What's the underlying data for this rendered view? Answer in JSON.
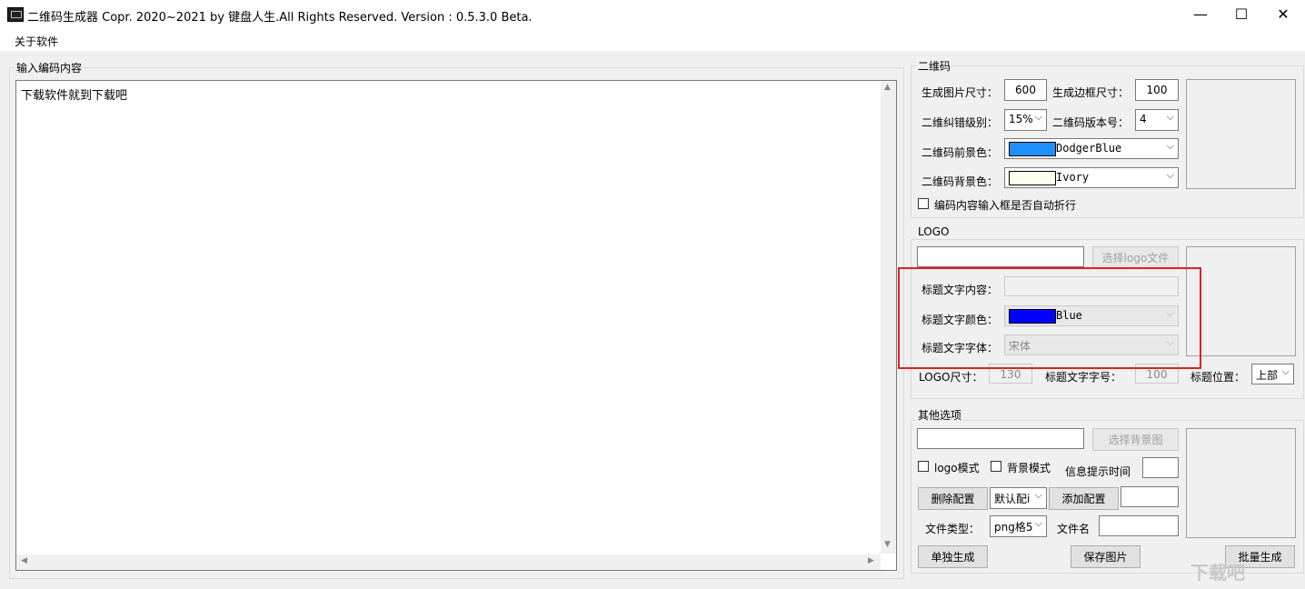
{
  "window": {
    "title": "二维码生成器  Copr. 2020~2021 by 键盘人生.All Rights Reserved.  Version : 0.5.3.0 Beta.",
    "minimize": "—",
    "maximize": "☐",
    "close": "✕"
  },
  "menu": {
    "about": "关于软件"
  },
  "input_group": {
    "label": "输入编码内容",
    "content": "下载软件就到下载吧"
  },
  "qr": {
    "group_label": "二维码",
    "image_size_label": "生成图片尺寸：",
    "image_size": "600",
    "border_size_label": "生成边框尺寸：",
    "border_size": "100",
    "ecc_label": "二维纠错级别：",
    "ecc": "15%",
    "version_label": "二维码版本号：",
    "version": "4",
    "fg_label": "二维码前景色：",
    "fg_name": "DodgerBlue",
    "fg_color": "#1e90ff",
    "bg_label": "二维码背景色：",
    "bg_name": "Ivory",
    "bg_color": "#fffff0",
    "wrap_label": "编码内容输入框是否自动折行"
  },
  "logo": {
    "group_label": "LOGO",
    "choose_button": "选择logo文件",
    "title_text_label": "标题文字内容：",
    "title_color_label": "标题文字颜色：",
    "title_color_name": "Blue",
    "title_color": "#0000ff",
    "title_font_label": "标题文字字体：",
    "title_font": "宋体",
    "logo_size_label": "LOGO尺寸：",
    "logo_size": "130",
    "title_font_size_label": "标题文字字号：",
    "title_font_size": "100",
    "title_pos_label": "标题位置：",
    "title_pos": "上部"
  },
  "other": {
    "group_label": "其他选项",
    "choose_bg_button": "选择背景图",
    "logo_mode": "logo模式",
    "bg_mode": "背景模式",
    "tip_time_label": "信息提示时间",
    "delete_config": "删除配置",
    "config_select": "默认配i",
    "add_config": "添加配置",
    "file_type_label": "文件类型：",
    "file_type": "png格5",
    "file_name_label": "文件名",
    "single_gen": "单独生成",
    "save_image": "保存图片",
    "batch_gen": "批量生成"
  },
  "watermark": "下载吧"
}
